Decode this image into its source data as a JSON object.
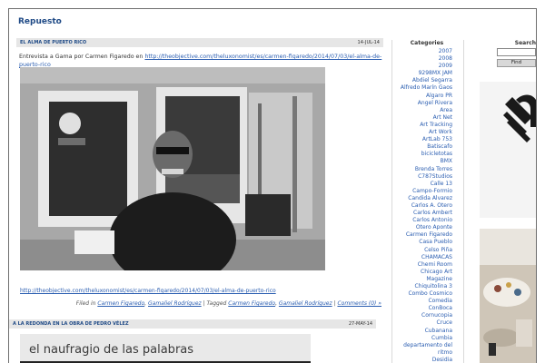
{
  "site": {
    "title": "Repuesto"
  },
  "post1": {
    "title": "EL ALMA DE PUERTO RICO",
    "date": "14-JUL-14",
    "intro_prefix": "Entrevista a Gama por Carmen Figaredo en ",
    "intro_link": "http://theobjective.com/theluxonomist/es/carmen-figaredo/2014/07/03/el-alma-de-puerto-rico",
    "body_link": "http://theobjective.com/theluxonomist/es/carmen-figaredo/2014/07/03/el-alma-de-puerto-rico",
    "filed_in_label": "Filed in ",
    "filed_cat_1": "Carmen Figaredo",
    "filed_sep": ", ",
    "filed_cat_2": "Gamaliel Rodríguez",
    "tagged_label": " | Tagged ",
    "tag_1": "Carmen Figaredo",
    "tag_sep": ", ",
    "tag_2": "Gamaliel Rodríguez",
    "comments_sep": " | ",
    "comments": "Comments (0) »"
  },
  "post2": {
    "title": "A LA REDONDA EN LA OBRA DE PEDRO VÉLEZ",
    "date": "27-MAY-14",
    "artwork_text": "el naufragio de las palabras"
  },
  "categories": {
    "title": "Categories",
    "items": [
      "2007",
      "2008",
      "2009",
      "9298MX JAM",
      "Abdiel Segarra",
      "Alfredo Marín Gaos",
      "Algaro PR",
      "Angel Rivera",
      "Area",
      "Art Net",
      "Art Tracking",
      "Art Work",
      "ArtLab 753",
      "Batiscafo",
      "bicicletotas",
      "BMX",
      "Brenda Torres",
      "C787Studios",
      "Calle 13",
      "Campo-Formio",
      "Candida Alvarez",
      "Carlos A. Otero",
      "Carlos Ambert",
      "Carlos Antonio",
      "Otero Aponte",
      "Carmen Figaredo",
      "Casa Pueblo",
      "Celso Piña",
      "CHAMACAS",
      "Chemi Room",
      "Chicago Art",
      "Magazine",
      "Chiquitolina 3",
      "Combo Cosmico",
      "Comedia",
      "ConBoca",
      "Cornucopia",
      "Cruce",
      "Cubanana",
      "Cumbia",
      "departamento del",
      "ritmo",
      "Desidia"
    ]
  },
  "search": {
    "label": "Search",
    "placeholder": "",
    "value": "",
    "button": "Find"
  }
}
